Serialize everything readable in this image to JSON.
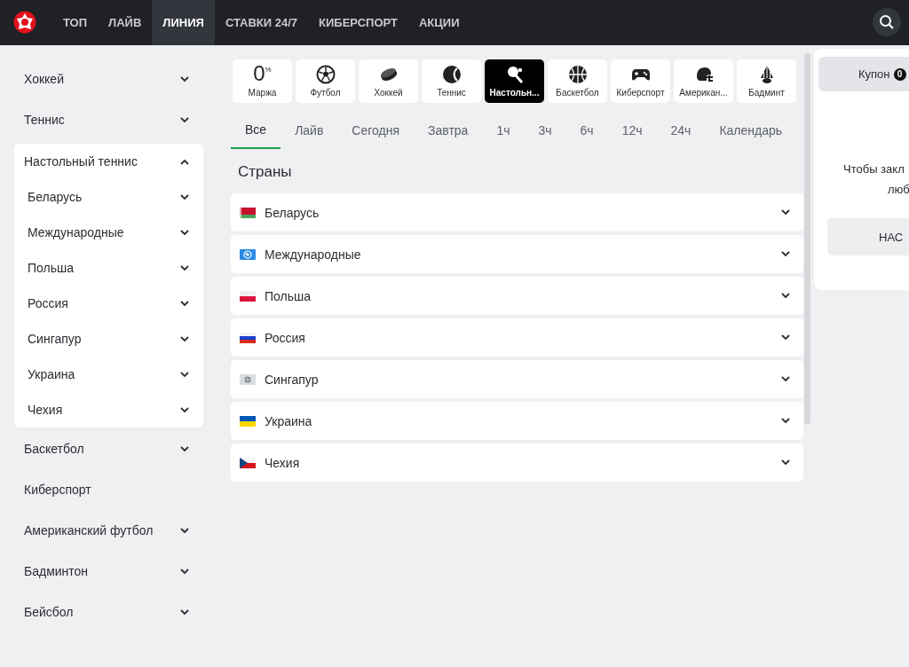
{
  "top_nav": {
    "items": [
      {
        "label": "ТОП",
        "selected": false
      },
      {
        "label": "ЛАЙВ",
        "selected": false
      },
      {
        "label": "ЛИНИЯ",
        "selected": true
      },
      {
        "label": "СТАВКИ 24/7",
        "selected": false
      },
      {
        "label": "КИБЕРСПОРТ",
        "selected": false
      },
      {
        "label": "АКЦИИ",
        "selected": false
      }
    ]
  },
  "sidebar": {
    "items": [
      {
        "label": "Хоккей",
        "kind": "group",
        "expanded": false
      },
      {
        "label": "Теннис",
        "kind": "group",
        "expanded": false
      },
      {
        "label": "Настольный теннис",
        "kind": "group",
        "expanded": true,
        "children": [
          {
            "label": "Беларусь",
            "expanded": false
          },
          {
            "label": "Международные",
            "expanded": false
          },
          {
            "label": "Польша",
            "expanded": false
          },
          {
            "label": "Россия",
            "expanded": false
          },
          {
            "label": "Сингапур",
            "expanded": false
          },
          {
            "label": "Украина",
            "expanded": false
          },
          {
            "label": "Чехия",
            "expanded": false
          }
        ]
      },
      {
        "label": "Баскетбол",
        "kind": "group",
        "expanded": false
      },
      {
        "label": "Киберспорт",
        "kind": "link"
      },
      {
        "label": "Американский футбол",
        "kind": "group",
        "expanded": false
      },
      {
        "label": "Бадминтон",
        "kind": "group",
        "expanded": false
      },
      {
        "label": "Бейсбол",
        "kind": "group",
        "expanded": false
      }
    ]
  },
  "sport_tiles": [
    {
      "kind": "margin",
      "value": "0",
      "unit": "%",
      "label": "Маржа",
      "selected": false
    },
    {
      "kind": "sport",
      "label": "Футбол",
      "selected": false
    },
    {
      "kind": "sport",
      "label": "Хоккей",
      "selected": false
    },
    {
      "kind": "sport",
      "label": "Теннис",
      "selected": false
    },
    {
      "kind": "sport",
      "label": "Настольн...",
      "selected": true
    },
    {
      "kind": "sport",
      "label": "Баскетбол",
      "selected": false
    },
    {
      "kind": "sport",
      "label": "Киберспорт",
      "selected": false
    },
    {
      "kind": "sport",
      "label": "Американ...",
      "selected": false
    },
    {
      "kind": "sport",
      "label": "Бадминт",
      "selected": false
    }
  ],
  "time_tabs": [
    {
      "label": "Все",
      "selected": true
    },
    {
      "label": "Лайв",
      "selected": false
    },
    {
      "label": "Сегодня",
      "selected": false
    },
    {
      "label": "Завтра",
      "selected": false
    },
    {
      "label": "1ч",
      "selected": false
    },
    {
      "label": "3ч",
      "selected": false
    },
    {
      "label": "6ч",
      "selected": false
    },
    {
      "label": "12ч",
      "selected": false
    },
    {
      "label": "24ч",
      "selected": false
    },
    {
      "label": "Календарь",
      "selected": false
    }
  ],
  "countries": {
    "title": "Страны",
    "rows": [
      {
        "label": "Беларусь",
        "expanded": false
      },
      {
        "label": "Международные",
        "expanded": false
      },
      {
        "label": "Польша",
        "expanded": false
      },
      {
        "label": "Россия",
        "expanded": false
      },
      {
        "label": "Сингапур",
        "expanded": false
      },
      {
        "label": "Украина",
        "expanded": false
      },
      {
        "label": "Чехия",
        "expanded": false
      }
    ]
  },
  "coupon": {
    "tab_label": "Купон",
    "count": "0",
    "message_lines": [
      "Чтобы закл",
      "люб"
    ],
    "button": "НАС"
  }
}
